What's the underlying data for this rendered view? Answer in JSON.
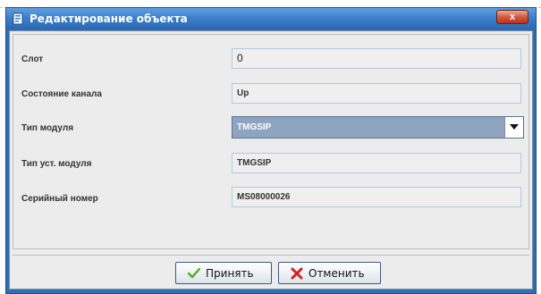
{
  "window": {
    "title": "Редактирование объекта",
    "close_glyph": "x"
  },
  "form": {
    "rows": [
      {
        "label": "Слот",
        "value": "0"
      },
      {
        "label": "Состояние канала",
        "value": "Up"
      },
      {
        "label": "Тип модуля",
        "value": "TMGSIP"
      },
      {
        "label": "Тип уст. модуля",
        "value": "TMGSIP"
      },
      {
        "label": "Серийный номер",
        "value": "MS08000026"
      }
    ]
  },
  "buttons": {
    "accept_label": "Принять",
    "cancel_label": "Отменить"
  },
  "icons": {
    "window": "window-app-icon",
    "close": "close-icon",
    "dropdown": "chevron-down-icon",
    "accept": "checkmark-icon",
    "cancel": "cross-icon"
  },
  "colors": {
    "titlebar": "#3b7fcb",
    "select_bg": "#8ea4c1",
    "accept_icon": "#4caf1e",
    "cancel_icon": "#d62020"
  }
}
